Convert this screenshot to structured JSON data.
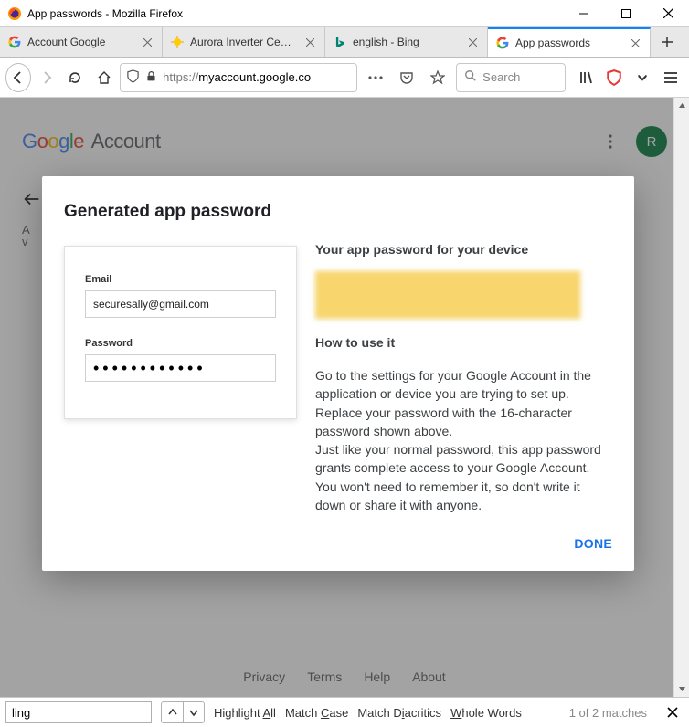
{
  "window": {
    "title": "App passwords - Mozilla Firefox"
  },
  "tabs": [
    {
      "label": "Account Google"
    },
    {
      "label": "Aurora Inverter Central"
    },
    {
      "label": "english - Bing"
    },
    {
      "label": "App passwords"
    }
  ],
  "urlbar": {
    "prefix": "https://",
    "domain": "myaccount.google.co",
    "suffix": ""
  },
  "search": {
    "placeholder": "Search"
  },
  "google_header": {
    "account_word": "Account",
    "avatar_letter": "R"
  },
  "page": {
    "title": "App passwords",
    "desc_line1": "A",
    "desc_line2": "v"
  },
  "modal": {
    "heading": "Generated app password",
    "subheading": "Your app password for your device",
    "howto_heading": "How to use it",
    "howto_body": "Go to the settings for your Google Account in the application or device you are trying to set up. Replace your password with the 16-character password shown above.\nJust like your normal password, this app password grants complete access to your Google Account. You won't need to remember it, so don't write it down or share it with anyone.",
    "done_label": "DONE",
    "card": {
      "email_label": "Email",
      "email_value": "securesally@gmail.com",
      "password_label": "Password",
      "password_dots": "••••••••••••"
    }
  },
  "footer": {
    "privacy": "Privacy",
    "terms": "Terms",
    "help": "Help",
    "about": "About"
  },
  "findbar": {
    "value": "ling",
    "highlight": "Highlight All",
    "matchcase": "Match Case",
    "diacritics": "Match Diacritics",
    "whole": "Whole Words",
    "matches": "1 of 2 matches"
  }
}
